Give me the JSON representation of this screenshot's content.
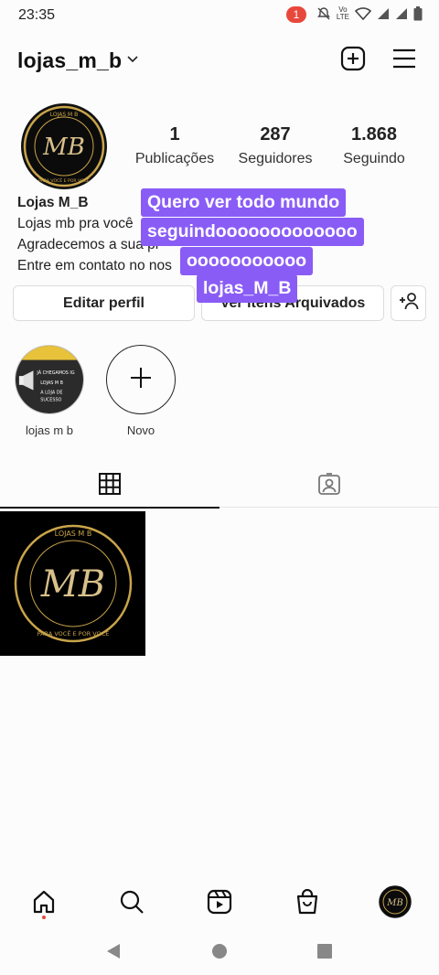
{
  "status_bar": {
    "time": "23:35",
    "notification_count": "1",
    "network_label_top": "Vo",
    "network_label_bottom": "LTE",
    "icons": [
      "mute-icon",
      "volte-icon",
      "wifi-icon",
      "signal-icon",
      "signal-icon",
      "battery-icon"
    ]
  },
  "header": {
    "username": "lojas_m_b",
    "icons": [
      "chevron-down-icon",
      "new-post-icon",
      "menu-icon"
    ]
  },
  "profile": {
    "avatar_text_top": "LOJAS M B",
    "avatar_monogram": "MB",
    "avatar_text_bottom": "PARA VOCÊ E POR VOCÊ",
    "stats": [
      {
        "value": "1",
        "label": "Publicações"
      },
      {
        "value": "287",
        "label": "Seguidores"
      },
      {
        "value": "1.868",
        "label": "Seguindo"
      }
    ],
    "display_name": "Lojas M_B",
    "bio_lines": [
      "Lojas mb pra você",
      "Agradecemos a sua pr",
      "Entre em contato no nos"
    ]
  },
  "overlay_text": {
    "lines": [
      "Quero ver todo mundo",
      "seguindooooooooooooo",
      "ooooooooooo",
      "lojas_M_B"
    ],
    "color": "#8a5cf6"
  },
  "buttons": {
    "edit_profile": "Editar perfil",
    "archived": "Ver itens Arquivados"
  },
  "highlights": [
    {
      "label": "lojas m b",
      "story_text": [
        "JÁ CHEGAMOS IG",
        "LOJAS M B",
        "A LOJA DE",
        "SUCESSO"
      ]
    },
    {
      "label": "Novo"
    }
  ],
  "tabs": [
    "grid-icon",
    "tagged-icon"
  ],
  "post": {
    "text_top": "LOJAS M B",
    "monogram": "MB",
    "text_bottom": "PARA VOCÊ E POR VOCÊ"
  },
  "bottom_nav": [
    "home-icon",
    "search-icon",
    "reels-icon",
    "shop-icon",
    "profile-avatar"
  ],
  "system_nav": [
    "back-icon",
    "home-circle-icon",
    "recents-icon"
  ],
  "colors": {
    "accent": "#8a5cf6",
    "badge": "#e8483b",
    "gold": "#c9a44a"
  }
}
